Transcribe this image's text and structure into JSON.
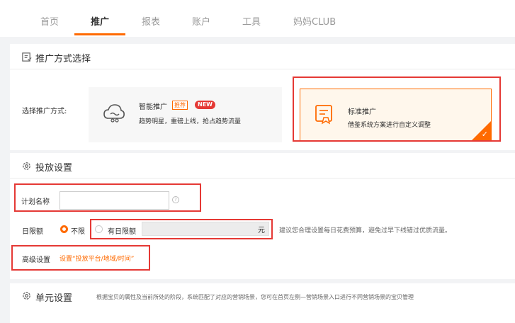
{
  "nav": {
    "tabs": [
      {
        "label": "首页",
        "active": false
      },
      {
        "label": "推广",
        "active": true
      },
      {
        "label": "报表",
        "active": false
      },
      {
        "label": "账户",
        "active": false
      },
      {
        "label": "工具",
        "active": false
      },
      {
        "label": "妈妈CLUB",
        "active": false
      }
    ]
  },
  "promo_method": {
    "section_title": "推广方式选择",
    "select_label": "选择推广方式:",
    "smart": {
      "title": "智能推广",
      "tag_recommend": "推荐",
      "tag_new": "NEW",
      "desc": "趋势明星，重磅上线，抢占趋势流量"
    },
    "standard": {
      "title": "标准推广",
      "desc": "借鉴系统方案进行自定义调整",
      "selected": true
    }
  },
  "delivery": {
    "section_title": "投放设置",
    "plan_name_label": "计划名称",
    "plan_name_value": "",
    "daily_budget_label": "日限额",
    "option_unlimited": "不限",
    "option_limited": "有日限额",
    "unit": "元",
    "budget_hint": "建议您合理设置每日花费预算，避免过早下线错过优质流量。",
    "advanced_label": "高级设置",
    "advanced_link": "设置“投放平台/地域/时间”"
  },
  "unit_settings": {
    "section_title": "单元设置",
    "desc": "根据宝贝的属性及当前所处的阶段，系统匹配了对应的营销场景，您可在首页左侧—营销场景入口进行不同营销场景的宝贝管理"
  },
  "colors": {
    "accent": "#ff6a00",
    "highlight_box": "#e53935"
  }
}
